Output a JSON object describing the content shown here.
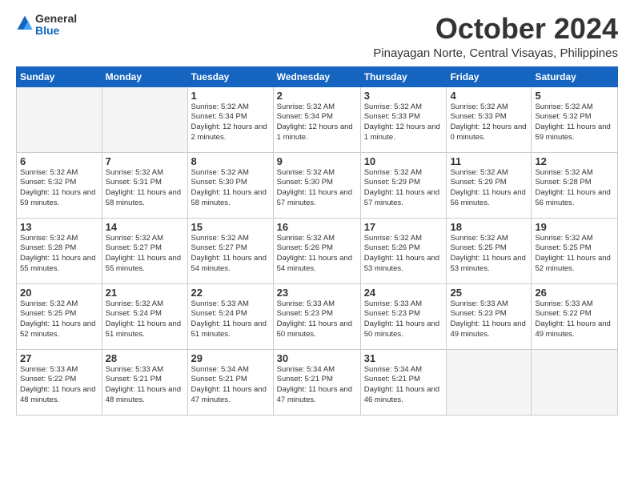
{
  "logo": {
    "text1": "General",
    "text2": "Blue"
  },
  "header": {
    "month": "October 2024",
    "location": "Pinayagan Norte, Central Visayas, Philippines"
  },
  "weekdays": [
    "Sunday",
    "Monday",
    "Tuesday",
    "Wednesday",
    "Thursday",
    "Friday",
    "Saturday"
  ],
  "weeks": [
    [
      {
        "day": "",
        "empty": true
      },
      {
        "day": "",
        "empty": true
      },
      {
        "day": "1",
        "sunrise": "5:32 AM",
        "sunset": "5:34 PM",
        "daylight": "12 hours and 2 minutes."
      },
      {
        "day": "2",
        "sunrise": "5:32 AM",
        "sunset": "5:34 PM",
        "daylight": "12 hours and 1 minute."
      },
      {
        "day": "3",
        "sunrise": "5:32 AM",
        "sunset": "5:33 PM",
        "daylight": "12 hours and 1 minute."
      },
      {
        "day": "4",
        "sunrise": "5:32 AM",
        "sunset": "5:33 PM",
        "daylight": "12 hours and 0 minutes."
      },
      {
        "day": "5",
        "sunrise": "5:32 AM",
        "sunset": "5:32 PM",
        "daylight": "11 hours and 59 minutes."
      }
    ],
    [
      {
        "day": "6",
        "sunrise": "5:32 AM",
        "sunset": "5:32 PM",
        "daylight": "11 hours and 59 minutes."
      },
      {
        "day": "7",
        "sunrise": "5:32 AM",
        "sunset": "5:31 PM",
        "daylight": "11 hours and 58 minutes."
      },
      {
        "day": "8",
        "sunrise": "5:32 AM",
        "sunset": "5:30 PM",
        "daylight": "11 hours and 58 minutes."
      },
      {
        "day": "9",
        "sunrise": "5:32 AM",
        "sunset": "5:30 PM",
        "daylight": "11 hours and 57 minutes."
      },
      {
        "day": "10",
        "sunrise": "5:32 AM",
        "sunset": "5:29 PM",
        "daylight": "11 hours and 57 minutes."
      },
      {
        "day": "11",
        "sunrise": "5:32 AM",
        "sunset": "5:29 PM",
        "daylight": "11 hours and 56 minutes."
      },
      {
        "day": "12",
        "sunrise": "5:32 AM",
        "sunset": "5:28 PM",
        "daylight": "11 hours and 56 minutes."
      }
    ],
    [
      {
        "day": "13",
        "sunrise": "5:32 AM",
        "sunset": "5:28 PM",
        "daylight": "11 hours and 55 minutes."
      },
      {
        "day": "14",
        "sunrise": "5:32 AM",
        "sunset": "5:27 PM",
        "daylight": "11 hours and 55 minutes."
      },
      {
        "day": "15",
        "sunrise": "5:32 AM",
        "sunset": "5:27 PM",
        "daylight": "11 hours and 54 minutes."
      },
      {
        "day": "16",
        "sunrise": "5:32 AM",
        "sunset": "5:26 PM",
        "daylight": "11 hours and 54 minutes."
      },
      {
        "day": "17",
        "sunrise": "5:32 AM",
        "sunset": "5:26 PM",
        "daylight": "11 hours and 53 minutes."
      },
      {
        "day": "18",
        "sunrise": "5:32 AM",
        "sunset": "5:25 PM",
        "daylight": "11 hours and 53 minutes."
      },
      {
        "day": "19",
        "sunrise": "5:32 AM",
        "sunset": "5:25 PM",
        "daylight": "11 hours and 52 minutes."
      }
    ],
    [
      {
        "day": "20",
        "sunrise": "5:32 AM",
        "sunset": "5:25 PM",
        "daylight": "11 hours and 52 minutes."
      },
      {
        "day": "21",
        "sunrise": "5:32 AM",
        "sunset": "5:24 PM",
        "daylight": "11 hours and 51 minutes."
      },
      {
        "day": "22",
        "sunrise": "5:33 AM",
        "sunset": "5:24 PM",
        "daylight": "11 hours and 51 minutes."
      },
      {
        "day": "23",
        "sunrise": "5:33 AM",
        "sunset": "5:23 PM",
        "daylight": "11 hours and 50 minutes."
      },
      {
        "day": "24",
        "sunrise": "5:33 AM",
        "sunset": "5:23 PM",
        "daylight": "11 hours and 50 minutes."
      },
      {
        "day": "25",
        "sunrise": "5:33 AM",
        "sunset": "5:23 PM",
        "daylight": "11 hours and 49 minutes."
      },
      {
        "day": "26",
        "sunrise": "5:33 AM",
        "sunset": "5:22 PM",
        "daylight": "11 hours and 49 minutes."
      }
    ],
    [
      {
        "day": "27",
        "sunrise": "5:33 AM",
        "sunset": "5:22 PM",
        "daylight": "11 hours and 48 minutes."
      },
      {
        "day": "28",
        "sunrise": "5:33 AM",
        "sunset": "5:21 PM",
        "daylight": "11 hours and 48 minutes."
      },
      {
        "day": "29",
        "sunrise": "5:34 AM",
        "sunset": "5:21 PM",
        "daylight": "11 hours and 47 minutes."
      },
      {
        "day": "30",
        "sunrise": "5:34 AM",
        "sunset": "5:21 PM",
        "daylight": "11 hours and 47 minutes."
      },
      {
        "day": "31",
        "sunrise": "5:34 AM",
        "sunset": "5:21 PM",
        "daylight": "11 hours and 46 minutes."
      },
      {
        "day": "",
        "empty": true
      },
      {
        "day": "",
        "empty": true
      }
    ]
  ]
}
